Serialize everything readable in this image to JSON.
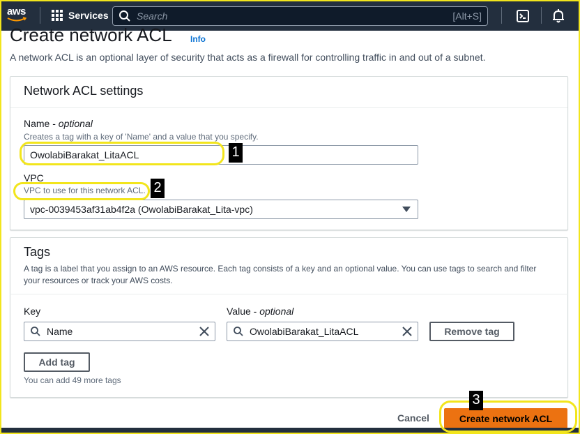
{
  "topnav": {
    "logo_text": "aws",
    "services_label": "Services",
    "search_placeholder": "Search",
    "search_shortcut": "[Alt+S]"
  },
  "page": {
    "title": "Create network ACL",
    "info_label": "Info",
    "description": "A network ACL is an optional layer of security that acts as a firewall for controlling traffic in and out of a subnet."
  },
  "settings": {
    "header": "Network ACL settings",
    "name_label": "Name - ",
    "name_optional": "optional",
    "name_desc": "Creates a tag with a key of 'Name' and a value that you specify.",
    "name_value": "OwolabiBarakat_LitaACL",
    "vpc_label": "VPC",
    "vpc_desc": "VPC to use for this network ACL.",
    "vpc_value": "vpc-0039453af31ab4f2a (OwolabiBarakat_Lita-vpc)"
  },
  "tags": {
    "header": "Tags",
    "desc_line1": "A tag is a label that you assign to an AWS resource. Each tag consists of a key and an optional value. You can use tags to search and filter",
    "desc_line2": "your resources or track your AWS costs.",
    "key_label": "Key",
    "value_label": "Value - ",
    "value_optional": "optional",
    "key_value": "Name",
    "value_value": "OwolabiBarakat_LitaACL",
    "remove_label": "Remove tag",
    "add_label": "Add tag",
    "remaining": "You can add 49 more tags"
  },
  "footer": {
    "cancel_label": "Cancel",
    "create_label": "Create network ACL"
  },
  "annotations": [
    "1",
    "2",
    "3"
  ],
  "colors": {
    "nav_bg": "#232f3e",
    "primary": "#ec7211",
    "link": "#0972d3",
    "highlight": "#f2e51c"
  }
}
